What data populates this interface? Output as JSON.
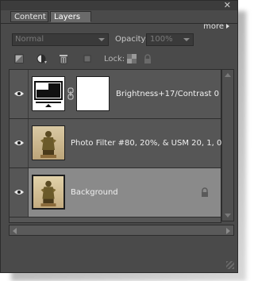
{
  "window": {
    "close_glyph": "✕"
  },
  "tabs": [
    {
      "label": "Content",
      "active": false
    },
    {
      "label": "Layers",
      "active": true
    }
  ],
  "more_label": "more",
  "blend_mode": {
    "value": "Normal"
  },
  "opacity": {
    "label": "Opacity:",
    "value": "100%"
  },
  "lock_label": "Lock:",
  "layers": [
    {
      "name": "Brightness+17/Contrast 0",
      "visible": true,
      "selected": false,
      "locked": false,
      "type": "adjustment"
    },
    {
      "name": "Photo Filter #80, 20%, & USM 20, 1, 0",
      "visible": true,
      "selected": false,
      "locked": false,
      "type": "image"
    },
    {
      "name": "Background",
      "visible": true,
      "selected": true,
      "locked": true,
      "type": "image"
    }
  ],
  "colors": {
    "panel": "#4a4a4a",
    "selected_row": "#8a8a8a",
    "text": "#f0f0f0"
  },
  "icons": [
    "close-icon",
    "menu-arrow-icon",
    "new-layer-icon",
    "adjustment-layer-icon",
    "trash-icon",
    "lock-transparent-icon",
    "lock-all-icon",
    "eye-icon",
    "link-icon",
    "lock-icon",
    "resize-grip-icon"
  ]
}
